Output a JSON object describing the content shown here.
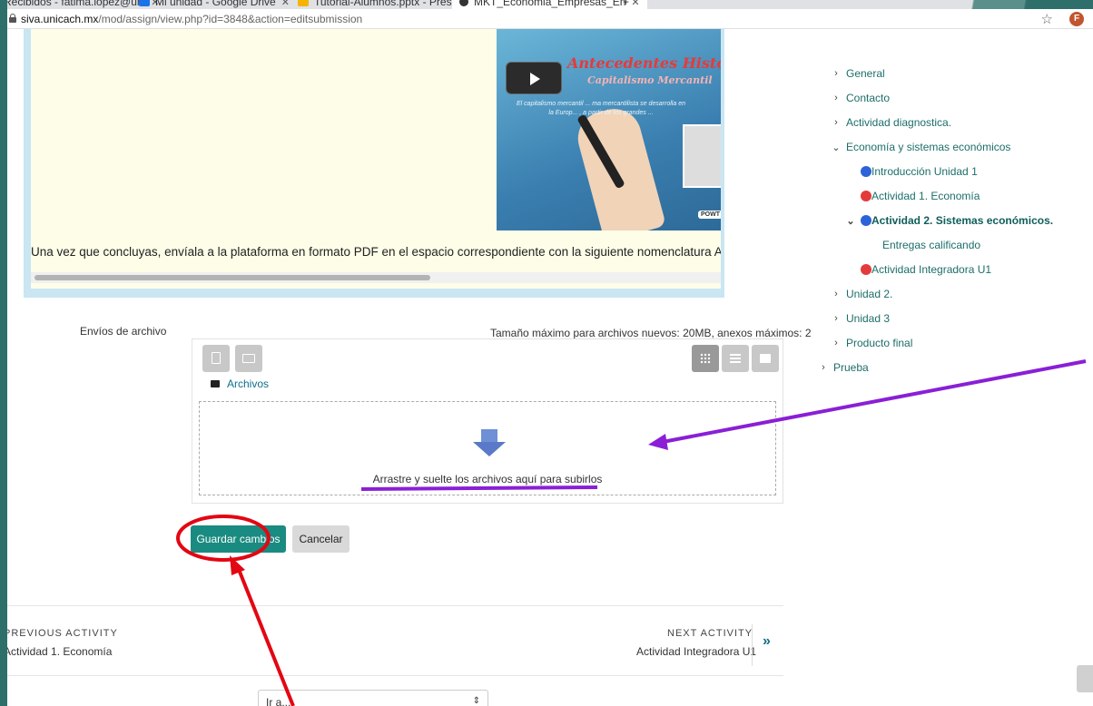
{
  "browser": {
    "tabs": [
      {
        "label": "Recibidos - fatima.lopez@uni",
        "color": "#d93025"
      },
      {
        "label": "Mi unidad - Google Drive",
        "color": "#1a73e8"
      },
      {
        "label": "Tutorial-Alumnos.pptx - Prese",
        "color": "#f4b400"
      },
      {
        "label": "MKT_Economia_Empresas_En",
        "color": "#333333"
      }
    ],
    "new_tab": "+",
    "url_domain": "siva.unicach.mx",
    "url_path": "/mod/assign/view.php?id=3848&action=editsubmission",
    "avatar_letter": "F",
    "star": "☆"
  },
  "content": {
    "video_title": "Antecedentes Históricos",
    "video_subtitle": "Capitalismo Mercantil",
    "video_desc": "El capitalismo mercantil ... ma mercantilista se desarrolla en la Europ... , a partir de los grandes ...",
    "video_logo": "POWT",
    "text": "Una vez que concluyas, envíala a la plataforma en formato PDF en el espacio correspondiente con la siguiente nomenclatura Apellidopaterno_mate"
  },
  "submission": {
    "file_label": "Envíos de archivo",
    "size_info": "Tamaño máximo para archivos nuevos: 20MB, anexos máximos: 2",
    "folder_label": "Archivos",
    "drop_text": "Arrastre y suelte los archivos aquí para subirlos",
    "save_label": "Guardar cambios",
    "cancel_label": "Cancelar"
  },
  "activity_nav": {
    "prev_label": "PREVIOUS ACTIVITY",
    "prev_link": "Actividad 1. Economía",
    "next_label": "NEXT ACTIVITY",
    "next_link": "Actividad Integradora U1",
    "next_arrow": "»",
    "jump_value": "Ir a...",
    "jump_caret": "⇕"
  },
  "sidebar": {
    "items": [
      {
        "label": "General",
        "chev": "›"
      },
      {
        "label": "Contacto",
        "chev": "›"
      },
      {
        "label": "Actividad diagnostica.",
        "chev": "›"
      },
      {
        "label": "Economía y sistemas económicos",
        "chev": "⌄"
      },
      {
        "label": "Introducción Unidad 1"
      },
      {
        "label": "Actividad 1. Economía"
      },
      {
        "label": "Actividad 2. Sistemas económicos.",
        "chev": "⌄"
      },
      {
        "label": "Entregas calificando"
      },
      {
        "label": "Actividad Integradora U1"
      },
      {
        "label": "Unidad 2.",
        "chev": "›"
      },
      {
        "label": "Unidad 3",
        "chev": "›"
      },
      {
        "label": "Producto final",
        "chev": "›"
      },
      {
        "label": "Prueba",
        "chev": "›"
      }
    ]
  },
  "colors": {
    "accent": "#1a8b80",
    "annotation_red": "#e30613",
    "annotation_purple": "#8a1fd6"
  }
}
